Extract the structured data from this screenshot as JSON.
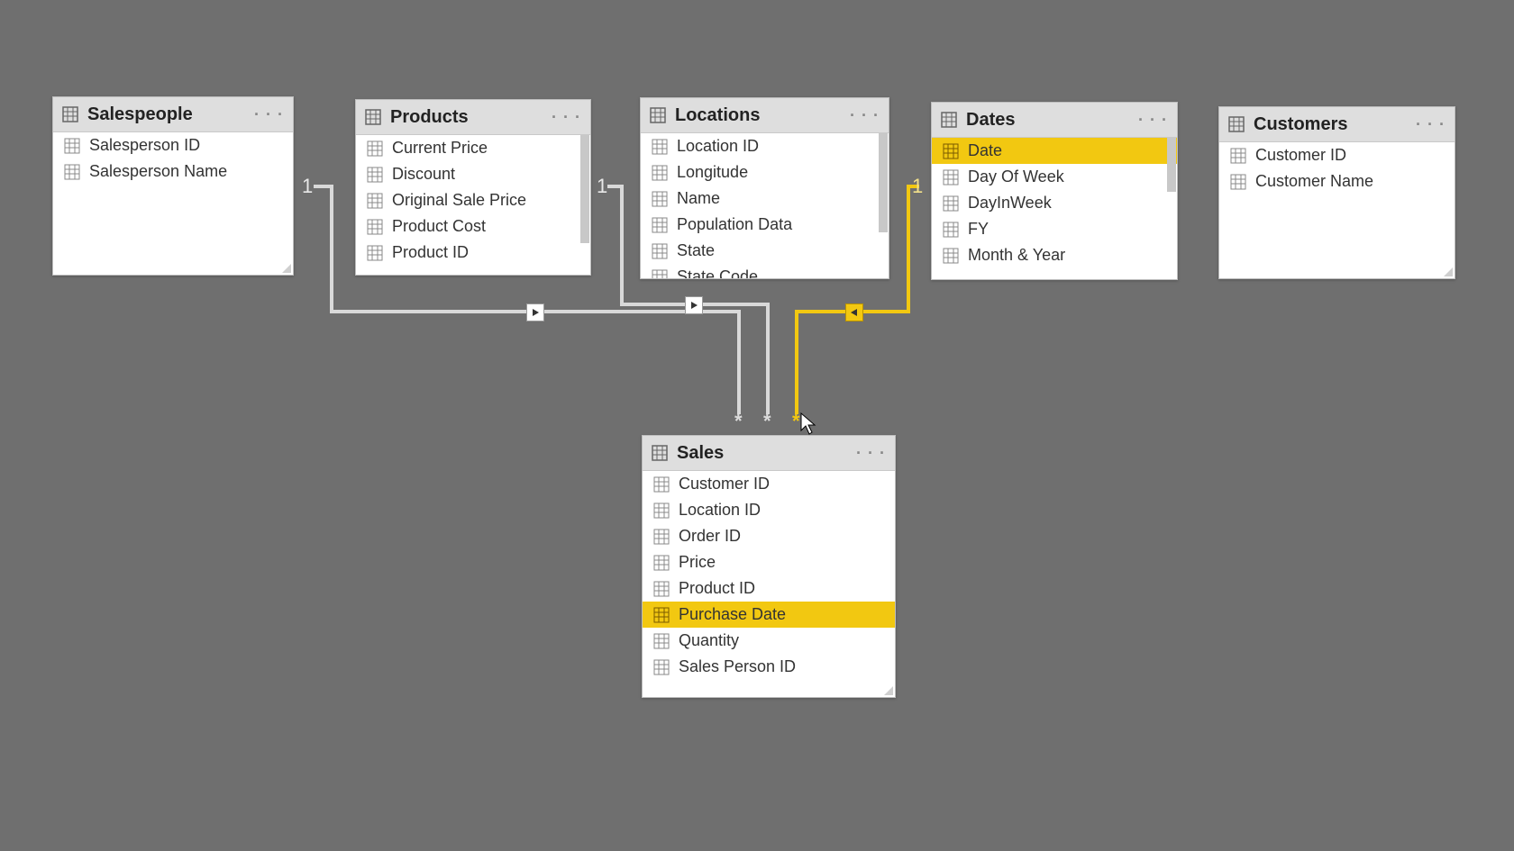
{
  "tables": {
    "salespeople": {
      "title": "Salespeople",
      "fields": [
        "Salesperson ID",
        "Salesperson Name"
      ]
    },
    "products": {
      "title": "Products",
      "fields": [
        "Current Price",
        "Discount",
        "Original Sale Price",
        "Product Cost",
        "Product ID"
      ]
    },
    "locations": {
      "title": "Locations",
      "fields": [
        "Location ID",
        "Longitude",
        "Name",
        "Population Data",
        "State",
        "State Code"
      ]
    },
    "dates": {
      "title": "Dates",
      "fields": [
        "Date",
        "Day Of Week",
        "DayInWeek",
        "FY",
        "Month & Year"
      ]
    },
    "customers": {
      "title": "Customers",
      "fields": [
        "Customer ID",
        "Customer Name"
      ]
    },
    "sales": {
      "title": "Sales",
      "fields": [
        "Customer ID",
        "Location ID",
        "Order ID",
        "Price",
        "Product ID",
        "Purchase Date",
        "Quantity",
        "Sales Person ID"
      ]
    }
  },
  "cardinality": {
    "one": "1",
    "many": "*"
  },
  "menu": "· · ·"
}
